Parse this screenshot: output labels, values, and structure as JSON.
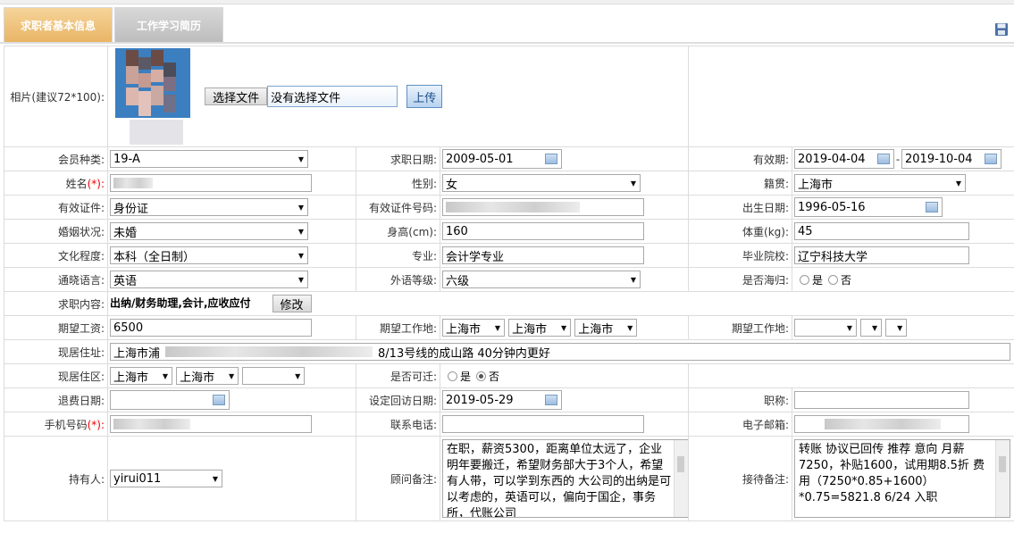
{
  "tabs": [
    "求职者基本信息",
    "工作学习简历"
  ],
  "photo": {
    "label": "相片(建议72*100):",
    "choose_btn": "选择文件",
    "no_file": "没有选择文件",
    "upload_btn": "上传"
  },
  "labels": {
    "member_type": "会员种类:",
    "job_date": "求职日期:",
    "valid_period": "有效期:",
    "name": "姓名",
    "gender": "性别:",
    "native": "籍贯:",
    "id_type": "有效证件:",
    "id_no": "有效证件号码:",
    "birth": "出生日期:",
    "marital": "婚姻状况:",
    "height": "身高(cm):",
    "weight": "体重(kg):",
    "education": "文化程度:",
    "major": "专业:",
    "school": "毕业院校:",
    "language": "通晓语言:",
    "lang_level": "外语等级:",
    "returnee": "是否海归:",
    "job_content": "求职内容:",
    "salary": "期望工资:",
    "work_place": "期望工作地:",
    "work_place2": "期望工作地:",
    "address": "现居住址:",
    "district": "现居住区:",
    "relocate": "是否可迁:",
    "refund_date": "退费日期:",
    "visit_date": "设定回访日期:",
    "title": "职称:",
    "mobile": "手机号码",
    "phone": "联系电话:",
    "email": "电子邮箱:",
    "holder": "持有人:",
    "consultant_note": "顾问备注:",
    "reception_note": "接待备注:"
  },
  "required_mark": "(*):",
  "values": {
    "member_type": "19-A",
    "job_date": "2009-05-01",
    "valid_from": "2019-04-04",
    "valid_dash": "-",
    "valid_to": "2019-10-04",
    "gender": "女",
    "native": "上海市",
    "id_type": "身份证",
    "birth": "1996-05-16",
    "marital": "未婚",
    "height": "160",
    "weight": "45",
    "education": "本科（全日制）",
    "major": "会计学专业",
    "school": "辽宁科技大学",
    "language": "英语",
    "lang_level": "六级",
    "job_content": "出纳/财务助理,会计,应收应付",
    "modify_btn": "修改",
    "salary": "6500",
    "wp1": "上海市",
    "wp2": "上海市",
    "wp3": "上海市",
    "addr_prefix": "上海市浦",
    "addr_suffix": "8/13号线的成山路 40分钟内更好",
    "dist1": "上海市",
    "dist2": "上海市",
    "visit_date": "2019-05-29",
    "holder": "yirui011",
    "consultant_note": "在职，薪资5300，距离单位太远了，企业明年要搬迁，希望财务部大于3个人，希望有人带，可以学到东西的 大公司的出纳是可以考虑的，英语可以，偏向于国企，事务所，代账公司",
    "reception_note": "转账 协议已回传 推荐 意向 月薪7250，补贴1600，试用期8.5折 费用（7250*0.85+1600）*0.75=5821.8 6/24 入职"
  },
  "radio": {
    "yes": "是",
    "no": "否"
  }
}
